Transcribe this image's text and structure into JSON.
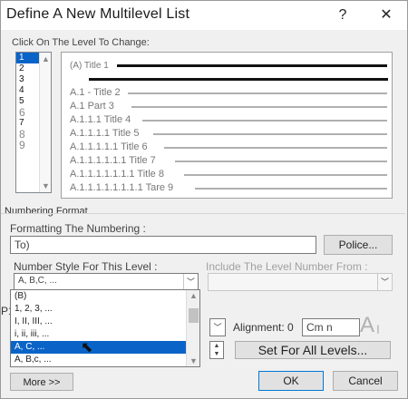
{
  "window": {
    "title": "Define A New Multilevel List",
    "help_label": "?",
    "close_label": "✕"
  },
  "levels": {
    "label": "Click On The Level To Change:",
    "items": [
      "1",
      "2",
      "3",
      "4",
      "5",
      "6",
      "7",
      "8",
      "9"
    ],
    "selected": "1"
  },
  "preview": {
    "lines": [
      "(A) Title 1",
      "A.1 - Title 2",
      "A.1 Part 3",
      "A.1.1.1 Title 4",
      "A.1.1.1.1 Title 5",
      "A.1.1.1.1.1 Title 6",
      "A.1.1.1.1.1.1 Title 7",
      "A.1.1.1.1.1.1.1 Title 8",
      "A.1.1.1.1.1.1.1.1 Tare 9"
    ]
  },
  "numbering": {
    "group_label": "Numbering Format",
    "formatting_label": "Formatting The Numbering :",
    "format_value": "To)",
    "police_button": "Police...",
    "style_label": "Number Style For This Level :",
    "style_value": "A, B,C, ...",
    "include_label": "Include The Level Number From :",
    "include_value": "",
    "style_options": [
      "(B)",
      "1, 2, 3, ...",
      "I, II, III, ...",
      "i, ii, iii, ...",
      "A, C, ...",
      "A, B,c, ..."
    ],
    "selected_option": "A, C, ...",
    "side_label": "P1"
  },
  "position": {
    "alignment_label": "Alignment: 0",
    "alignment_value": "Cm n",
    "set_all_button": "Set For All Levels..."
  },
  "footer": {
    "more_button": "More >>",
    "ok_button": "OK",
    "cancel_button": "Cancel"
  }
}
